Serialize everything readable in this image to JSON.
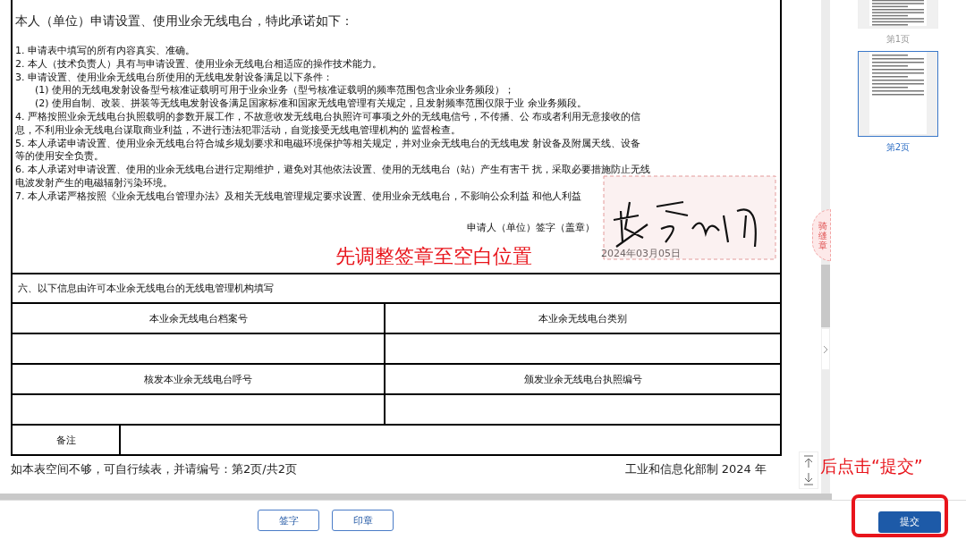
{
  "document": {
    "heading": "本人（单位）申请设置、使用业余无线电台，特此承诺如下：",
    "lines": [
      {
        "text": "1. 申请表中填写的所有内容真实、准确。",
        "indent": false
      },
      {
        "text": "2. 本人（技术负责人）具有与申请设置、使用业余无线电台相适应的操作技术能力。",
        "indent": false
      },
      {
        "text": "3. 申请设置、使用业余无线电台所使用的无线电发射设备满足以下条件：",
        "indent": false
      },
      {
        "text": "(1) 使用的无线电发射设备型号核准证载明可用于业余业务（型号核准证载明的频率范围包含业余业务频段）；",
        "indent": true
      },
      {
        "text": "(2) 使用自制、改装、拼装等无线电发射设备满足国家标准和国家无线电管理有关规定，且发射频率范围仅限于业 余业务频段。",
        "indent": true
      },
      {
        "text": "4. 严格按照业余无线电台执照载明的参数开展工作，不故意收发无线电台执照许可事项之外的无线电信号，不传播、公 布或者利用无意接收的信",
        "indent": false
      },
      {
        "text": "息，不利用业余无线电台谋取商业利益，不进行违法犯罪活动，自觉接受无线电管理机构的 监督检查。",
        "indent": false
      },
      {
        "text": "5. 本人承诺申请设置、使用业余无线电台符合城乡规划要求和电磁环境保护等相关规定，并对业余无线电台的无线电发 射设备及附属天线、设备",
        "indent": false
      },
      {
        "text": "等的使用安全负责。",
        "indent": false
      },
      {
        "text": "6. 本人承诺对申请设置、使用的业余无线电台进行定期维护，避免对其他依法设置、使用的无线电台（站）产生有害干 扰，采取必要措施防止无线",
        "indent": false
      },
      {
        "text": "电波发射产生的电磁辐射污染环境。",
        "indent": false
      },
      {
        "text": "7. 本人承诺严格按照《业余无线电台管理办法》及相关无线电管理规定要求设置、使用业余无线电台，不影响公众利益 和他人利益",
        "indent": false
      }
    ],
    "signer_label": "申请人（单位）签字（盖章）",
    "date": "2024年03月05日"
  },
  "hint_top": "先调整签章至空白位置",
  "section6": {
    "title": "六、以下信息由许可本业余无线电台的无线电管理机构填写",
    "rows": [
      {
        "kind": "header",
        "cells": [
          "本业余无线电台档案号",
          "本业余无线电台类别"
        ]
      },
      {
        "kind": "blank"
      },
      {
        "kind": "header",
        "cells": [
          "核发本业余无线电台呼号",
          "颁发业余无线电台执照编号"
        ]
      },
      {
        "kind": "blank"
      }
    ],
    "remarks_label": "备注"
  },
  "footer_left": "如本表空间不够，可自行续表，并请编号：第2页/共2页",
  "footer_right": "工业和信息化部制 2024 年",
  "thumbnails": [
    {
      "label": "第1页",
      "selected": false
    },
    {
      "label": "第2页",
      "selected": true
    }
  ],
  "seal_tab": "骑缝章",
  "toolbar": {
    "buttons": [
      "签字",
      "印章"
    ],
    "submit": "提交"
  },
  "hint_bottom": "后点击“提交”"
}
